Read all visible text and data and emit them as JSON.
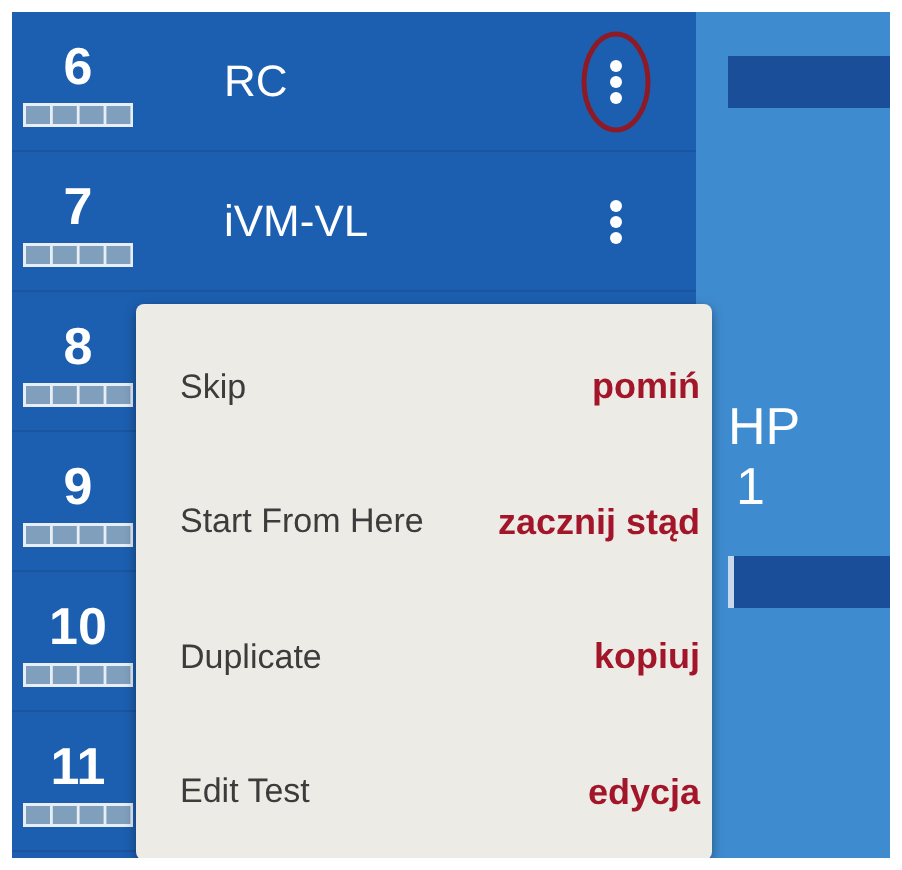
{
  "rows": [
    {
      "number": "6",
      "name": "RC",
      "annotated": true
    },
    {
      "number": "7",
      "name": "iVM-VL",
      "annotated": false
    },
    {
      "number": "8"
    },
    {
      "number": "9"
    },
    {
      "number": "10"
    },
    {
      "number": "11"
    }
  ],
  "side_panel": {
    "label": "HP",
    "value": "1"
  },
  "context_menu": {
    "items": [
      {
        "label": "Skip",
        "note": "pomiń"
      },
      {
        "label": "Start From Here",
        "note": "zacznij stąd"
      },
      {
        "label": "Duplicate",
        "note": "kopiuj"
      },
      {
        "label": "Edit Test",
        "note": "edycja"
      }
    ]
  }
}
